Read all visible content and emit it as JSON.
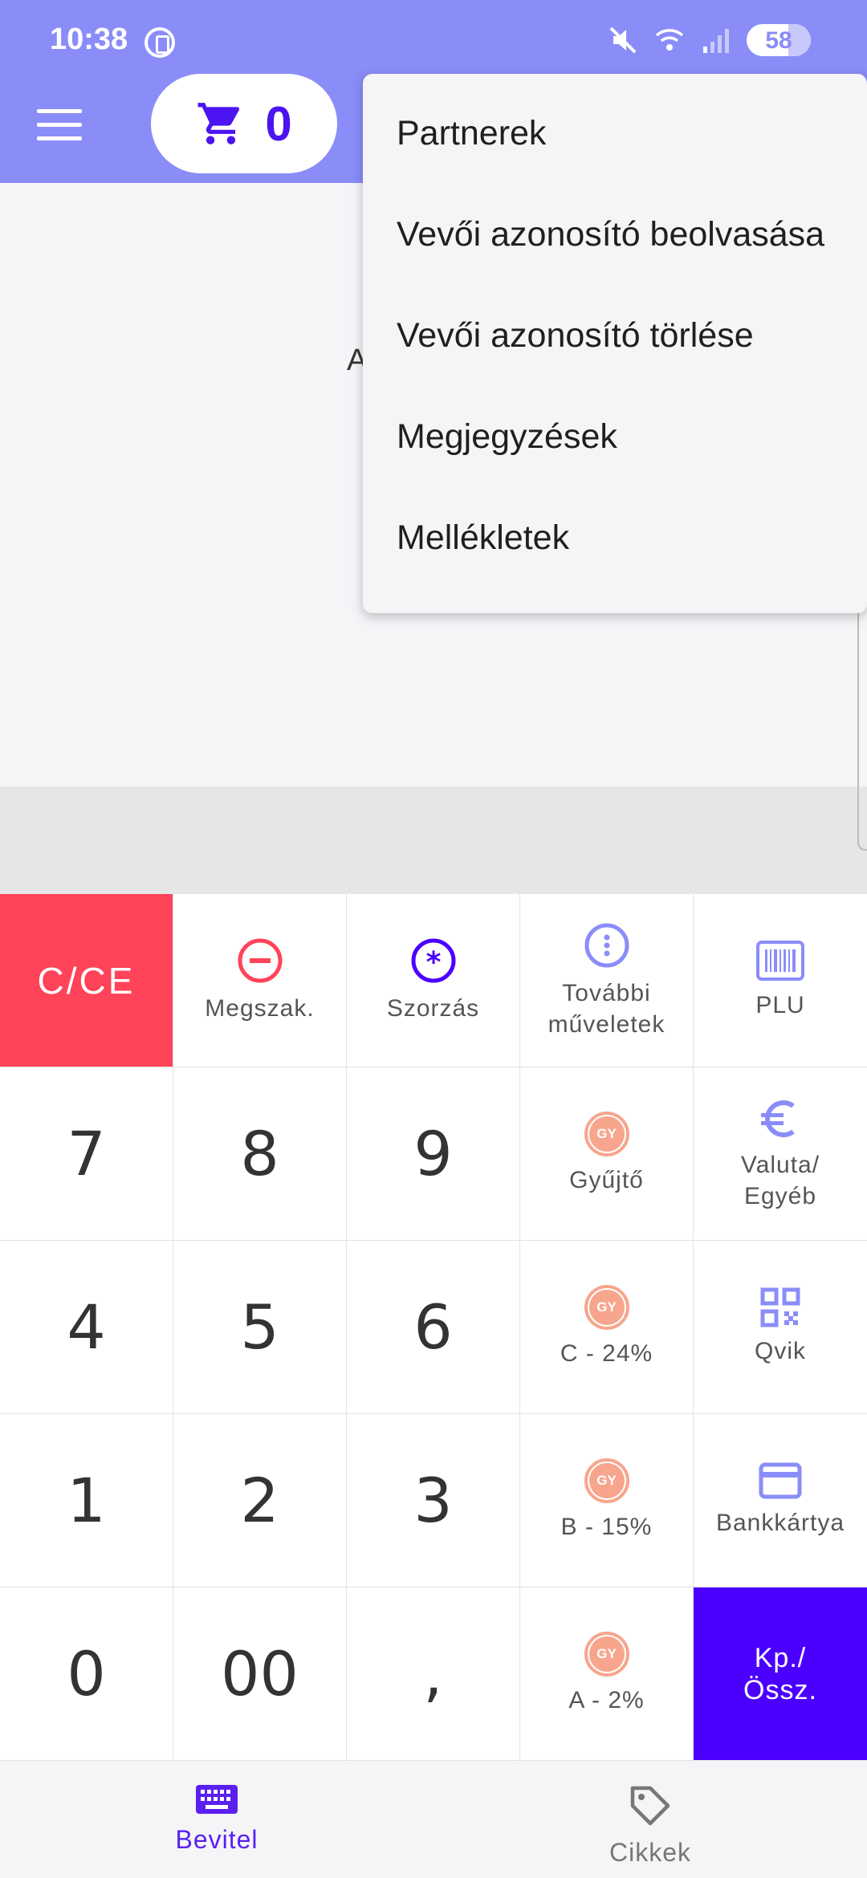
{
  "status_bar": {
    "time": "10:38",
    "battery": "58"
  },
  "header": {
    "cart_count": "0"
  },
  "content": {
    "partial_text": "A"
  },
  "dropdown": {
    "items": [
      {
        "label": "Partnerek"
      },
      {
        "label": "Vevői azonosító beolvasása"
      },
      {
        "label": "Vevői azonosító törlése"
      },
      {
        "label": "Megjegyzések"
      },
      {
        "label": "Mellékletek"
      }
    ]
  },
  "keypad": {
    "cce": "C/CE",
    "megszak": "Megszak.",
    "szorzas": "Szorzás",
    "tovabbi_1": "További",
    "tovabbi_2": "műveletek",
    "plu": "PLU",
    "k7": "7",
    "k8": "8",
    "k9": "9",
    "gyujto": "Gyűjtő",
    "valuta_1": "Valuta/",
    "valuta_2": "Egyéb",
    "k4": "4",
    "k5": "5",
    "k6": "6",
    "vat_c": "C - 24%",
    "qvik": "Qvik",
    "k1": "1",
    "k2": "2",
    "k3": "3",
    "vat_b": "B - 15%",
    "bankkartya": "Bankkártya",
    "k0": "0",
    "k00": "00",
    "comma": ",",
    "vat_a": "A - 2%",
    "total_1": "Kp./",
    "total_2": "Össz.",
    "gy_badge": "GY"
  },
  "bottom_nav": {
    "bevitel": "Bevitel",
    "cikkek": "Cikkek"
  },
  "colors": {
    "header": "#8a8df8",
    "accent": "#4b00ff",
    "clear": "#ff4359",
    "vat": "#f7a58c",
    "icon_purple": "#8a8df8"
  }
}
